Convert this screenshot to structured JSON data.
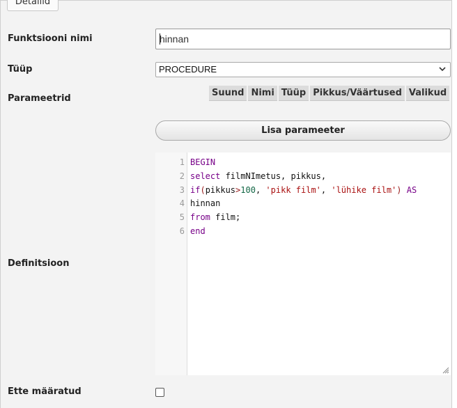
{
  "tab": {
    "label": "Detailid"
  },
  "form": {
    "name_label": "Funktsiooni nimi",
    "name_value": "hinnan",
    "type_label": "Tüüp",
    "type_value": "PROCEDURE",
    "params_label": "Parameetrid",
    "param_columns": [
      "Suund",
      "Nimi",
      "Tüüp",
      "Pikkus/Väärtused",
      "Valikud"
    ],
    "add_param_button": "Lisa parameeter",
    "definition_label": "Definitsioon",
    "deterministic_label": "Ette määratud",
    "deterministic_checked": false
  },
  "editor": {
    "line_numbers": [
      "1",
      "2",
      "3",
      "4",
      "5",
      "6"
    ],
    "lines": [
      [
        {
          "t": "BEGIN",
          "c": "kw"
        }
      ],
      [
        {
          "t": "select",
          "c": "kw"
        },
        {
          "t": " filmNImetus, pikkus,",
          "c": "plain"
        }
      ],
      [
        {
          "t": "if",
          "c": "kw"
        },
        {
          "t": "(",
          "c": "op"
        },
        {
          "t": "pikkus",
          "c": "plain"
        },
        {
          "t": ">",
          "c": "op"
        },
        {
          "t": "100",
          "c": "num"
        },
        {
          "t": ", ",
          "c": "plain"
        },
        {
          "t": "'pikk film'",
          "c": "str"
        },
        {
          "t": ", ",
          "c": "plain"
        },
        {
          "t": "'lühike film'",
          "c": "str"
        },
        {
          "t": ")",
          "c": "op"
        },
        {
          "t": " ",
          "c": "plain"
        },
        {
          "t": "AS",
          "c": "kw"
        }
      ],
      [
        {
          "t": "hinnan",
          "c": "plain"
        }
      ],
      [
        {
          "t": "from",
          "c": "kw"
        },
        {
          "t": " film;",
          "c": "plain"
        }
      ],
      [
        {
          "t": "end",
          "c": "kw"
        }
      ]
    ]
  }
}
